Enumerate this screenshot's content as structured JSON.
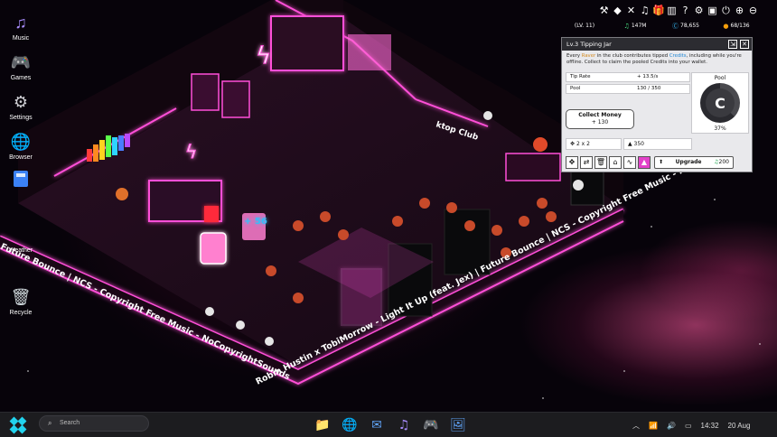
{
  "desktop": {
    "icons": [
      {
        "label": "Music",
        "icon": "music-note-icon",
        "glyph": "♫",
        "color": "#a78bfa"
      },
      {
        "label": "Games",
        "icon": "gamepad-icon",
        "glyph": "🎮",
        "color": "#9aa3b5"
      },
      {
        "label": "Settings",
        "icon": "gear-icon",
        "glyph": "⚙",
        "color": "#cfcfd4"
      },
      {
        "label": "Browser",
        "icon": "globe-icon",
        "glyph": "🌐",
        "color": "#38bdf8"
      },
      {
        "label": "Weather",
        "icon": "weather-icon",
        "glyph": "",
        "color": "#fbbf24"
      },
      {
        "label": "Recycle",
        "icon": "recycle-bin-icon",
        "glyph": "🗑",
        "color": "#cfd8dc"
      }
    ]
  },
  "game": {
    "banner_lines": [
      "Future Bounce | NCS - Copyright Free Music - NoCopyrightSounds",
      "Robin Hustin x TobiMorrow - Light It Up (feat. Jex) | Future Bounce | NCS - Copyright Free Music - NoCopyright"
    ],
    "club_sign": "ktop Club",
    "tip_float": "+ 56",
    "hud": {
      "icons": [
        "hammer-wrench-icon",
        "diamond-icon",
        "shuffle-icon",
        "music-icon",
        "gift-icon",
        "chart-icon",
        "question-icon",
        "settings-icon",
        "save-icon",
        "power-icon",
        "zoom-in-icon",
        "zoom-out-icon"
      ],
      "glyphs": [
        "⚒",
        "◆",
        "✕",
        "♫",
        "🎁",
        "▥",
        "?",
        "⚙",
        "▣",
        "⏻",
        "⊕",
        "⊖"
      ],
      "stats": [
        {
          "label": "(LV. 11)",
          "icon": ""
        },
        {
          "label": "147M",
          "icon": "♫",
          "color": "#4ade80"
        },
        {
          "label": "78,655",
          "icon": "Ⓒ",
          "color": "#38bdf8"
        },
        {
          "label": "68/136",
          "icon": "●",
          "color": "#f59e0b"
        }
      ]
    },
    "panel": {
      "title": "Lv.3 Tipping Jar",
      "desc_pre": "Every ",
      "desc_raver": "Raver",
      "desc_mid": " in the club contributes tipped ",
      "desc_credits": "Credits",
      "desc_post": ", including while you're offline. Collect to claim the pooled Credits into your wallet.",
      "tip_rate_label": "Tip Rate",
      "tip_rate_value": "+ 13.5/s",
      "pool_label": "Pool",
      "pool_value": "130 / 350",
      "pool_title": "Pool",
      "pool_percent": "37%",
      "pool_fill": 0.37,
      "collect_label": "Collect Money",
      "collect_amount": "+ 130",
      "size_value": "2 x 2",
      "cost_value": "350",
      "upgrade_label": "Upgrade",
      "upgrade_cost": "200",
      "tools": [
        "move-icon",
        "swap-icon",
        "trash-icon",
        "store-icon",
        "activity-icon",
        "jar-icon"
      ],
      "tool_glyphs": [
        "✥",
        "⇄",
        "🗑",
        "⌂",
        "∿",
        "▲"
      ]
    }
  },
  "taskbar": {
    "search_placeholder": "Search",
    "apps": [
      {
        "name": "file-explorer-icon",
        "glyph": "📁",
        "color": "#f5c542"
      },
      {
        "name": "browser-icon",
        "glyph": "🌐",
        "color": "#38bdf8"
      },
      {
        "name": "mail-icon",
        "glyph": "✉",
        "color": "#60a5fa"
      },
      {
        "name": "music-icon",
        "glyph": "♫",
        "color": "#a78bfa"
      },
      {
        "name": "games-icon",
        "glyph": "🎮",
        "color": "#9aa3b5"
      },
      {
        "name": "photos-icon",
        "glyph": "🖼",
        "color": "#60a5fa"
      }
    ],
    "time": "14:32",
    "date": "20 Aug"
  }
}
